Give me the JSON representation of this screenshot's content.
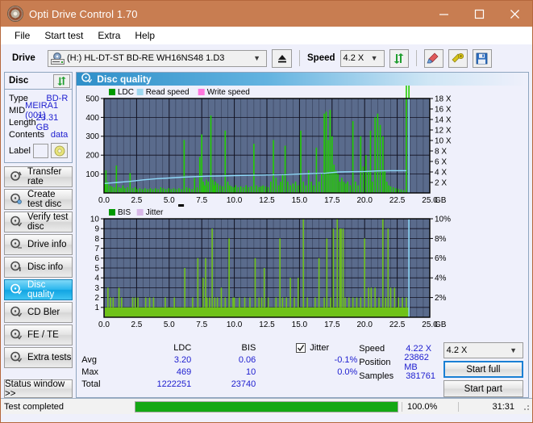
{
  "window": {
    "title": "Opti Drive Control 1.70",
    "icon": "disc-icon",
    "minimize": "minimize-icon",
    "maximize": "maximize-icon",
    "close": "close-icon"
  },
  "menu": {
    "items": [
      "File",
      "Start test",
      "Extra",
      "Help"
    ]
  },
  "toolbar": {
    "drive_label": "Drive",
    "drive_value": "(H:)  HL-DT-ST BD-RE  WH16NS48 1.D3",
    "eject": "eject-icon",
    "speed_label": "Speed",
    "speed_value": "4.2 X",
    "refresh": "refresh-icon",
    "erase": "erase-icon",
    "tools": "tools-icon",
    "save": "save-icon"
  },
  "disc_panel": {
    "title": "Disc",
    "refresh": "refresh-icon",
    "rows": [
      {
        "key": "Type",
        "value": "BD-R"
      },
      {
        "key": "MID",
        "value": "MEIRA1 (001)"
      },
      {
        "key": "Length",
        "value": "23.31 GB"
      },
      {
        "key": "Contents",
        "value": "data"
      }
    ],
    "label_key": "Label",
    "label_value": "",
    "label_button": "disc-label-icon"
  },
  "nav": {
    "items": [
      {
        "label": "Transfer rate",
        "active": false
      },
      {
        "label": "Create test disc",
        "active": false
      },
      {
        "label": "Verify test disc",
        "active": false
      },
      {
        "label": "Drive info",
        "active": false
      },
      {
        "label": "Disc info",
        "active": false
      },
      {
        "label": "Disc quality",
        "active": true
      },
      {
        "label": "CD Bler",
        "active": false
      },
      {
        "label": "FE / TE",
        "active": false
      },
      {
        "label": "Extra tests",
        "active": false
      }
    ],
    "status_window": "Status window >>"
  },
  "main": {
    "header_title": "Disc quality",
    "header_icon": "disc-quality-icon"
  },
  "stats": {
    "col_headers": [
      "LDC",
      "BIS"
    ],
    "rows": [
      {
        "name": "Avg",
        "ldc": "3.20",
        "bis": "0.06",
        "jitter": "-0.1%"
      },
      {
        "name": "Max",
        "ldc": "469",
        "bis": "10",
        "jitter": "0.0%"
      },
      {
        "name": "Total",
        "ldc": "1222251",
        "bis": "23740",
        "jitter": ""
      }
    ],
    "jitter_label": "Jitter",
    "jitter_checked": true,
    "speed_key": "Speed",
    "speed_value": "4.22 X",
    "position_key": "Position",
    "position_value": "23862 MB",
    "samples_key": "Samples",
    "samples_value": "381761",
    "speed_select": "4.2 X",
    "start_full": "Start full",
    "start_part": "Start part"
  },
  "statusbar": {
    "text": "Test completed",
    "progress_pct": 100.0,
    "progress_label": "100.0%",
    "elapsed": "31:31"
  },
  "colors": {
    "titlebar": "#c87d51",
    "plot_bg": "#5a6b8c",
    "ldc_green": "#22cc00",
    "bis_green": "#6fc21a",
    "read_speed": "#8ed8f8",
    "write_speed": "#ff7fe0",
    "jitter": "#d8b8e8",
    "accent_blue": "#2020d0",
    "progress_green": "#14a814"
  },
  "chart_data": [
    {
      "type": "line",
      "id": "disc-quality-ldc-chart",
      "title": "",
      "xlabel": "GB",
      "ylabel": "",
      "xlim": [
        0,
        25.0
      ],
      "ylim": [
        0,
        500
      ],
      "y2lim": [
        0,
        18
      ],
      "y2label": "X",
      "grid": true,
      "legend_position": "top-left",
      "legend": [
        {
          "name": "LDC",
          "color": "#009900"
        },
        {
          "name": "Read speed",
          "color": "#9fd8f0"
        },
        {
          "name": "Write speed",
          "color": "#ff77dd"
        }
      ],
      "xticks": [
        "0.0",
        "2.5",
        "5.0",
        "7.5",
        "10.0",
        "12.5",
        "15.0",
        "17.5",
        "20.0",
        "22.5",
        "25.0"
      ],
      "yticks": [
        100,
        200,
        300,
        400,
        500
      ],
      "y2ticks": [
        "2 X",
        "4 X",
        "6 X",
        "8 X",
        "10 X",
        "12 X",
        "14 X",
        "16 X",
        "18 X"
      ],
      "series": [
        {
          "name": "LDC",
          "kind": "impulse",
          "color": "#22cc00",
          "x": [
            0.05,
            0.15,
            0.28,
            0.45,
            0.6,
            0.78,
            0.95,
            1.15,
            1.3,
            1.45,
            1.6,
            1.8,
            2.0,
            2.2,
            2.4,
            2.55,
            2.75,
            2.95,
            3.15,
            3.35,
            3.55,
            3.75,
            3.95,
            4.15,
            4.35,
            4.55,
            4.75,
            4.95,
            5.15,
            5.35,
            5.55,
            5.75,
            5.95,
            6.15,
            6.35,
            6.55,
            6.75,
            6.95,
            7.15,
            7.35,
            7.5,
            7.62,
            7.72,
            7.85,
            8.0,
            8.2,
            8.35,
            8.45,
            8.55,
            8.7,
            8.9,
            9.1,
            9.3,
            9.5,
            9.65,
            9.8,
            9.95,
            10.1,
            10.3,
            10.5,
            10.7,
            10.9,
            11.1,
            11.3,
            11.5,
            11.7,
            11.9,
            12.05,
            12.2,
            12.4,
            12.6,
            12.8,
            13.0,
            13.2,
            13.4,
            13.55,
            13.7,
            13.9,
            14.1,
            14.3,
            14.5,
            14.7,
            14.9,
            15.1,
            15.3,
            15.5,
            15.7,
            15.9,
            16.1,
            16.3,
            16.5,
            16.7,
            16.9,
            17.05,
            17.2,
            17.35,
            17.5,
            17.65,
            17.8,
            17.95,
            18.1,
            18.25,
            18.4,
            18.55,
            18.7,
            18.9,
            19.1,
            19.3,
            19.5,
            19.7,
            19.9,
            20.1,
            20.3,
            20.45,
            20.6,
            20.8,
            21.0,
            21.2,
            21.4,
            21.55,
            21.7,
            21.85,
            22.0,
            22.2,
            22.4,
            22.6,
            22.8,
            23.0,
            23.2,
            23.4
          ],
          "y": [
            55,
            120,
            60,
            40,
            35,
            30,
            145,
            30,
            25,
            40,
            25,
            30,
            105,
            25,
            30,
            20,
            25,
            20,
            25,
            20,
            25,
            20,
            25,
            20,
            30,
            25,
            20,
            25,
            20,
            25,
            20,
            25,
            20,
            280,
            30,
            25,
            20,
            80,
            30,
            190,
            310,
            60,
            40,
            70,
            60,
            410,
            70,
            40,
            60,
            50,
            40,
            35,
            330,
            60,
            40,
            35,
            30,
            40,
            30,
            35,
            30,
            40,
            30,
            35,
            260,
            40,
            30,
            35,
            40,
            35,
            30,
            60,
            280,
            80,
            40,
            60,
            100,
            250,
            60,
            40,
            50,
            60,
            40,
            330,
            60,
            40,
            120,
            60,
            40,
            240,
            60,
            100,
            420,
            430,
            280,
            440,
            300,
            150,
            120,
            100,
            60,
            80,
            60,
            50,
            60,
            40,
            380,
            60,
            40,
            300,
            140,
            200,
            120,
            330,
            60,
            400,
            420,
            360,
            300,
            120,
            60,
            40,
            35,
            30,
            25,
            20,
            18,
            15
          ]
        },
        {
          "name": "Read speed",
          "kind": "line",
          "color": "#8ed8f8",
          "x": [
            0.0,
            1.0,
            2.0,
            3.0,
            4.0,
            5.0,
            6.0,
            7.0,
            8.0,
            9.0,
            10.0,
            11.0,
            12.0,
            13.0,
            14.0,
            15.0,
            16.0,
            17.0,
            18.0,
            19.0,
            20.0,
            21.0,
            22.0,
            23.2
          ],
          "y_x_units": [
            1.8,
            2.0,
            2.2,
            2.5,
            2.7,
            2.85,
            3.0,
            3.1,
            3.2,
            3.25,
            3.3,
            3.35,
            3.4,
            3.45,
            3.5,
            3.6,
            3.7,
            3.75,
            4.0,
            4.05,
            4.1,
            4.2,
            4.25,
            4.25
          ]
        },
        {
          "name": "Write speed",
          "kind": "line",
          "color": "#ff7fe0",
          "x": [],
          "y": []
        }
      ],
      "cursor_x": 23.4
    },
    {
      "type": "line",
      "id": "disc-quality-bis-chart",
      "title": "",
      "xlabel": "GB",
      "ylabel": "",
      "xlim": [
        0,
        25.0
      ],
      "ylim": [
        0,
        10
      ],
      "y2lim": [
        0,
        10
      ],
      "y2label": "%",
      "grid": true,
      "legend_position": "top-left",
      "legend": [
        {
          "name": "BIS",
          "color": "#009900"
        },
        {
          "name": "Jitter",
          "color": "#d8b8e8"
        }
      ],
      "xticks": [
        "0.0",
        "2.5",
        "5.0",
        "7.5",
        "10.0",
        "12.5",
        "15.0",
        "17.5",
        "20.0",
        "22.5",
        "25.0"
      ],
      "yticks": [
        1,
        2,
        3,
        4,
        5,
        6,
        7,
        8,
        9,
        10
      ],
      "y2ticks": [
        "2%",
        "4%",
        "6%",
        "8%",
        "10%"
      ],
      "series": [
        {
          "name": "BIS",
          "kind": "impulse",
          "color": "#6fc21a",
          "baseline": 1,
          "x": [
            0.3,
            0.5,
            0.7,
            1.15,
            1.35,
            1.6,
            2.2,
            2.4,
            2.6,
            2.9,
            3.2,
            3.5,
            3.8,
            4.1,
            4.4,
            4.7,
            5.0,
            5.4,
            5.8,
            6.2,
            6.4,
            6.8,
            7.2,
            7.6,
            7.8,
            7.9,
            8.1,
            8.3,
            8.5,
            8.7,
            9.0,
            9.3,
            9.6,
            9.9,
            10.0,
            10.4,
            10.8,
            11.2,
            11.6,
            11.9,
            12.1,
            12.3,
            12.6,
            12.9,
            13.2,
            13.5,
            13.7,
            14.0,
            14.3,
            14.6,
            14.9,
            15.3,
            15.6,
            15.9,
            16.2,
            16.5,
            16.9,
            17.1,
            17.4,
            17.6,
            17.9,
            18.1,
            18.2,
            18.35,
            18.5,
            18.8,
            19.1,
            19.4,
            19.7,
            20.0,
            20.3,
            20.5,
            20.8,
            21.1,
            21.4,
            21.6,
            21.8,
            22.0,
            22.3,
            22.6,
            22.9,
            23.2
          ],
          "y": [
            3,
            2,
            2,
            3,
            2,
            1,
            2,
            2,
            2,
            1,
            2,
            2,
            2,
            1,
            1,
            2,
            1,
            2,
            1,
            5,
            1,
            2,
            6,
            4,
            6,
            2,
            2,
            9,
            2,
            2,
            3,
            2,
            8,
            2,
            2,
            2,
            2,
            2,
            6,
            2,
            2,
            5,
            2,
            1,
            2,
            8,
            2,
            2,
            4,
            2,
            4,
            10,
            2,
            1,
            2,
            6,
            2,
            8,
            2,
            9,
            10,
            9,
            9,
            9,
            2,
            2,
            2,
            2,
            2,
            8,
            3,
            3,
            3,
            2,
            10,
            2,
            9,
            3,
            3,
            2,
            2,
            2
          ]
        },
        {
          "name": "Jitter",
          "kind": "line",
          "color": "#d8b8e8",
          "x": [],
          "y": []
        }
      ],
      "cursor_x": 23.4
    }
  ]
}
